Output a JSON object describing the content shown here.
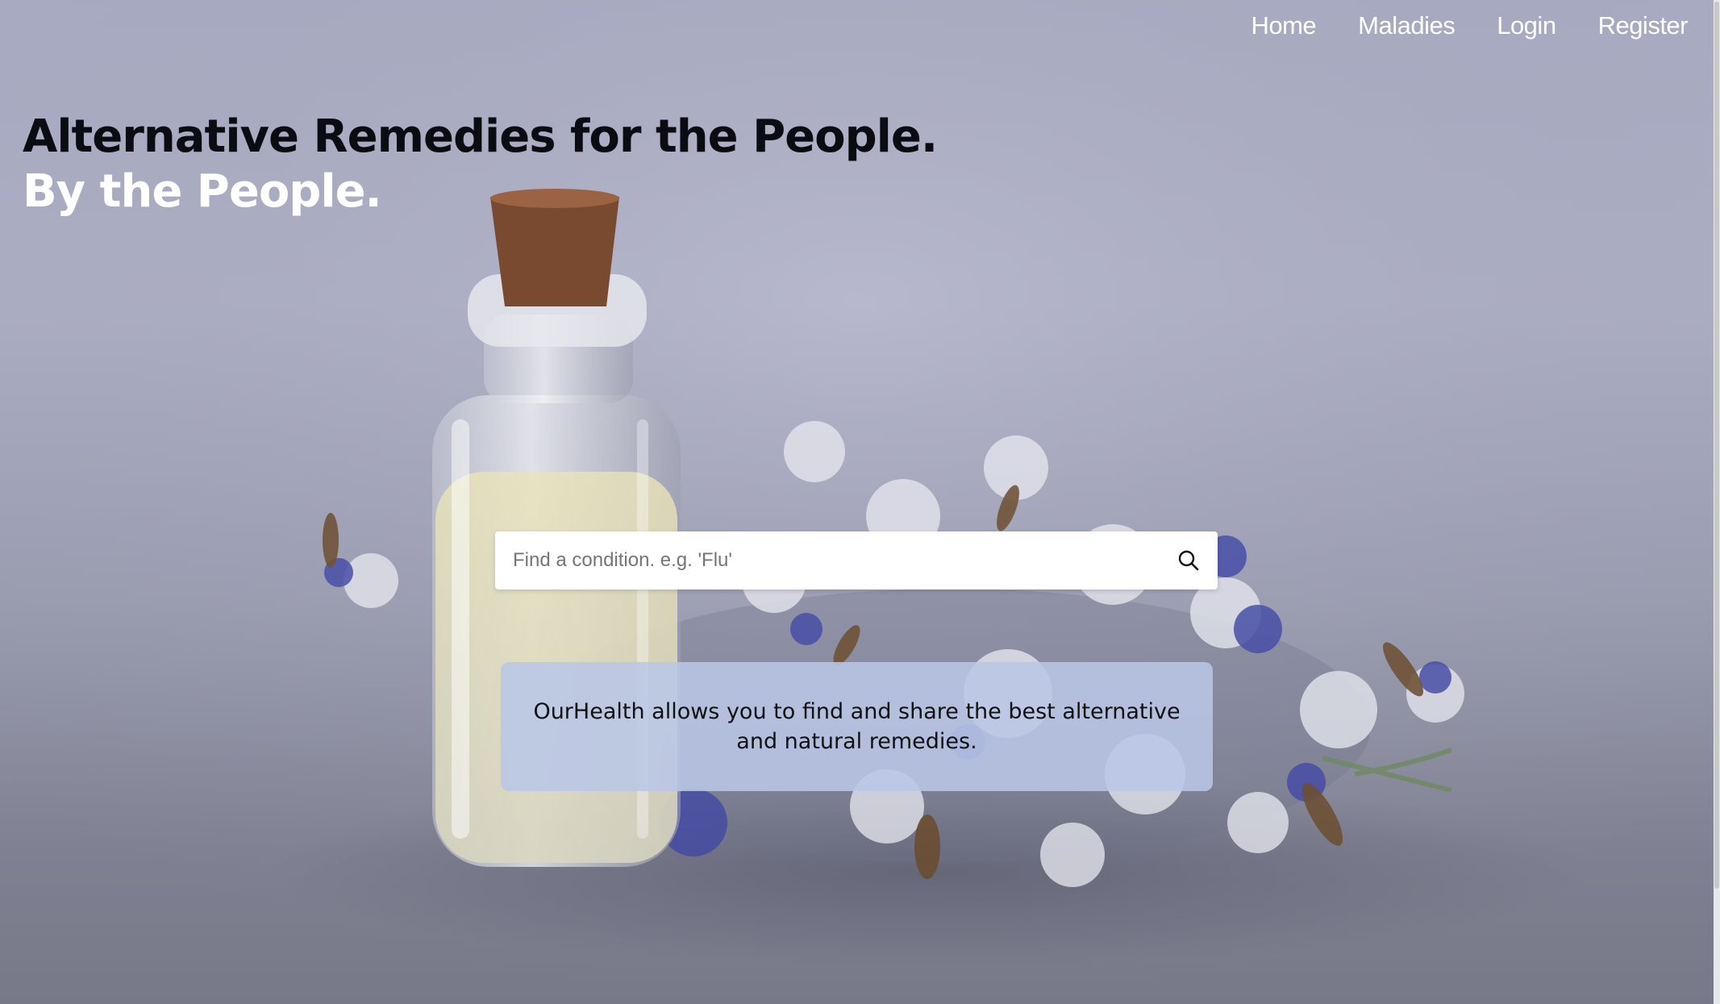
{
  "nav": {
    "items": [
      {
        "label": "Home"
      },
      {
        "label": "Maladies"
      },
      {
        "label": "Login"
      },
      {
        "label": "Register"
      }
    ]
  },
  "hero": {
    "line1": "Alternative Remedies for the People.",
    "line2": "By the People."
  },
  "search": {
    "placeholder": "Find a condition. e.g. 'Flu'",
    "value": "",
    "icon": "search-icon"
  },
  "info": {
    "text": "OurHealth allows you to find and share the best alternative and natural remedies."
  },
  "colors": {
    "background": "#a9acc3",
    "hero_dark": "#0b0b12",
    "hero_light": "#ffffff",
    "info_box": "#bac6e6"
  }
}
